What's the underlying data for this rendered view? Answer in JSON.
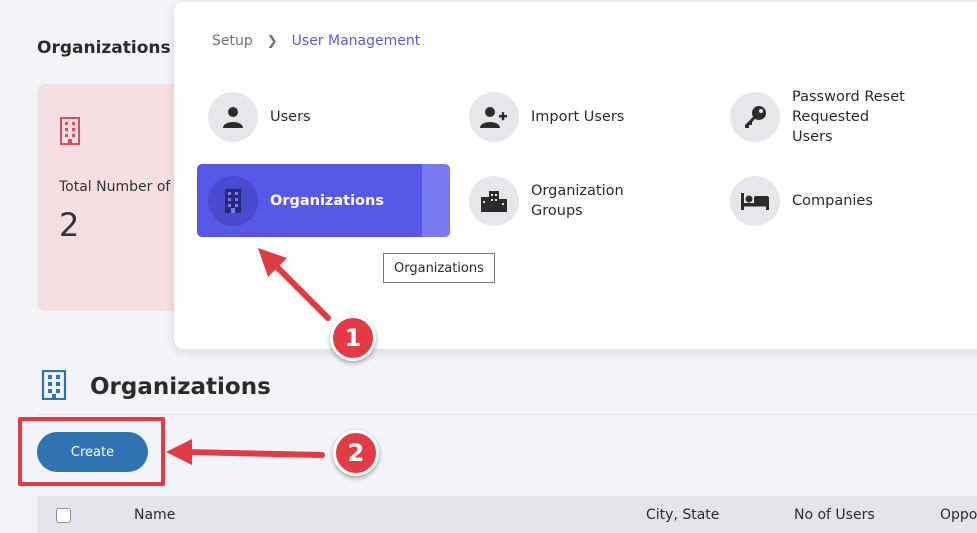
{
  "background": {
    "summary_title": "Organizations S",
    "summary_card": {
      "label": "Total Number of",
      "value": "2",
      "icon": "building-icon",
      "bg_color": "#f5dfe3",
      "icon_color": "#e24b5a"
    },
    "section_title": "Organizations",
    "create_label": "Create",
    "create_color": "#2f73b1",
    "table_columns": [
      "Name",
      "City, State",
      "No of Users",
      "Oppo"
    ]
  },
  "menu": {
    "breadcrumb": [
      "Setup",
      "User Management"
    ],
    "items": [
      {
        "label": "Users",
        "icon": "user-icon"
      },
      {
        "label": "Import Users",
        "icon": "user-plus-icon"
      },
      {
        "label": "Password Reset Requested Users",
        "icon": "key-icon"
      },
      {
        "label": "Organizations",
        "icon": "building-icon",
        "active": true
      },
      {
        "label": "Organization Groups",
        "icon": "city-icon"
      },
      {
        "label": "Companies",
        "icon": "bed-icon"
      }
    ],
    "active_color": "#5757e8",
    "tooltip": "Organizations"
  },
  "annotations": {
    "badge_1": "1",
    "badge_2": "2",
    "color": "#e33b45"
  }
}
